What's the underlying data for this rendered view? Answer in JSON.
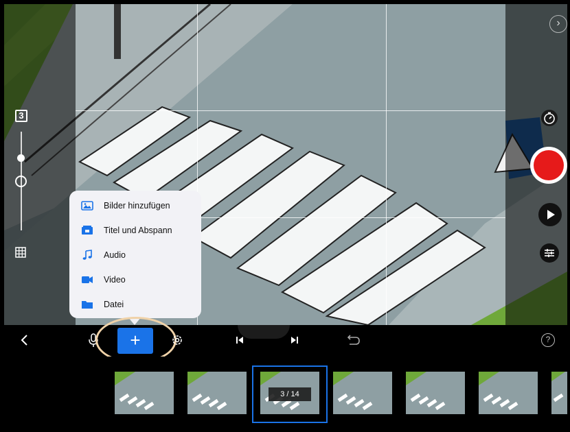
{
  "popup_menu": {
    "items": [
      {
        "label": "Bilder hinzufügen",
        "icon": "photos-icon"
      },
      {
        "label": "Titel und Abspann",
        "icon": "title-card-icon"
      },
      {
        "label": "Audio",
        "icon": "music-note-icon"
      },
      {
        "label": "Video",
        "icon": "video-camera-icon"
      },
      {
        "label": "Datei",
        "icon": "folder-icon"
      }
    ]
  },
  "left_controls": {
    "layers_count": "3"
  },
  "toolbar": {
    "add_label": "+",
    "help_label": "?"
  },
  "filmstrip": {
    "frame_counter": "3 / 14",
    "current_frame": 3,
    "total_frames": 14
  },
  "colors": {
    "accent": "#1a73e8",
    "record": "#e61a1a",
    "highlight_ring": "#f0d2a8",
    "menu_bg": "#f2f2f6"
  }
}
